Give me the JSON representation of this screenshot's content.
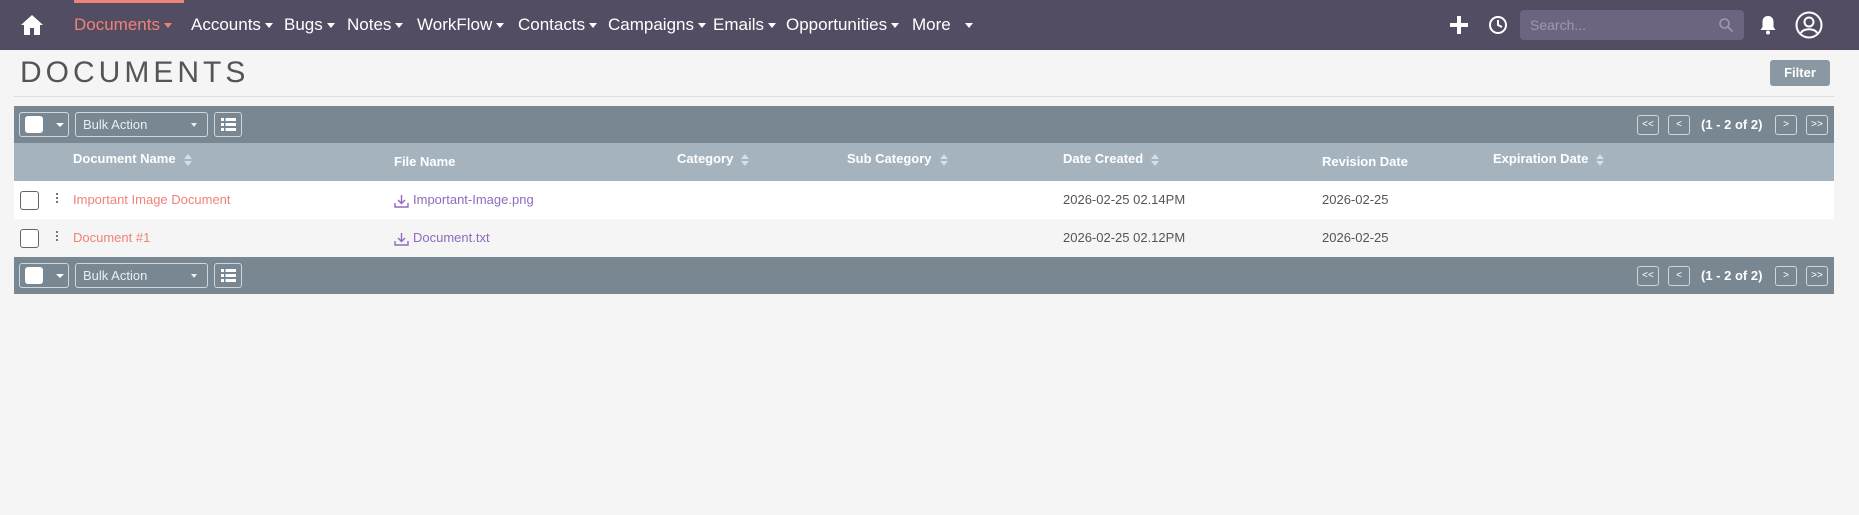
{
  "nav": {
    "items": [
      {
        "label": "Documents",
        "active": true
      },
      {
        "label": "Accounts"
      },
      {
        "label": "Bugs"
      },
      {
        "label": "Notes"
      },
      {
        "label": "WorkFlow"
      },
      {
        "label": "Contacts"
      },
      {
        "label": "Campaigns"
      },
      {
        "label": "Emails"
      },
      {
        "label": "Opportunities"
      },
      {
        "label": "More"
      }
    ],
    "search_placeholder": "Search...",
    "icons": [
      "home-icon",
      "plus-icon",
      "history-icon",
      "search-icon",
      "bell-icon",
      "user-avatar-icon"
    ]
  },
  "header": {
    "title": "DOCUMENTS",
    "filter_label": "Filter"
  },
  "toolbar": {
    "bulk_action": "Bulk Action",
    "pagination": {
      "first": "<<",
      "prev": "<",
      "count": "(1 - 2 of 2)",
      "next": ">",
      "last": ">>"
    }
  },
  "table": {
    "columns": [
      "Document Name",
      "File Name",
      "Category",
      "Sub Category",
      "Date Created",
      "Revision Date",
      "Expiration Date"
    ],
    "rows": [
      {
        "name": "Important Image Document",
        "file": "Important-Image.png",
        "category": "",
        "sub_category": "",
        "date_created": "2026-02-25 02.14PM",
        "revision_date": "2026-02-25",
        "expiration_date": ""
      },
      {
        "name": "Document #1",
        "file": "Document.txt",
        "category": "",
        "sub_category": "",
        "date_created": "2026-02-25 02.12PM",
        "revision_date": "2026-02-25",
        "expiration_date": ""
      }
    ]
  },
  "colors": {
    "nav_bg": "#534d64",
    "accent": "#f08377",
    "link": "#8e6bbf",
    "bar": "#788792",
    "header_row": "#a5b3bf"
  }
}
